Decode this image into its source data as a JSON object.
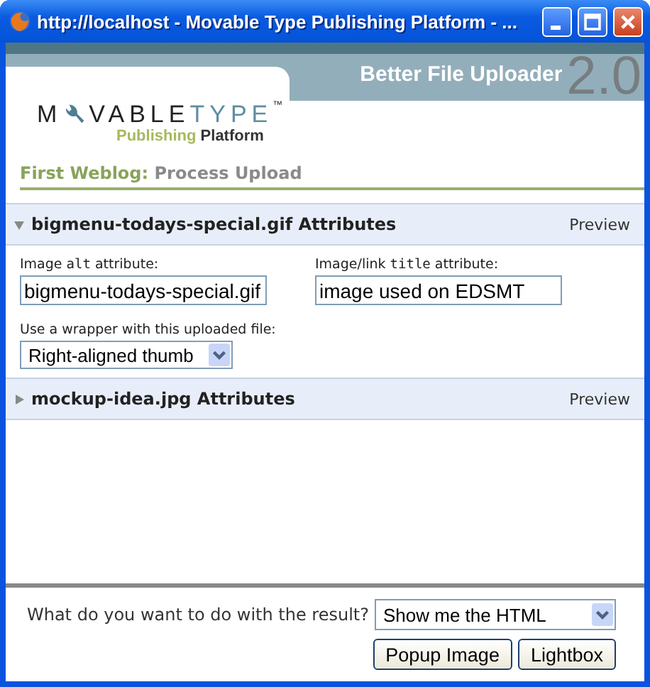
{
  "window": {
    "title": "http://localhost - Movable Type Publishing Platform - ..."
  },
  "logo": {
    "first": "M",
    "rest": "VABLE",
    "accent": "TYPE",
    "mark": "™",
    "tagline_1": "Publishing",
    "tagline_2": "Platform"
  },
  "app_title": "Better File Uploader",
  "version": "2.0",
  "breadcrumb": {
    "blog": "First Weblog:",
    "page": "Process Upload"
  },
  "sections": [
    {
      "title": "bigmenu-todays-special.gif Attributes",
      "preview": "Preview",
      "expanded": true,
      "fields": [
        {
          "label": "Image **alt** attribute:",
          "value": "bigmenu-todays-special.gif"
        },
        {
          "label": "Image/link **title** attribute:",
          "value": "image used on EDSMT"
        }
      ],
      "wrapper": {
        "label": "Use a wrapper with this uploaded file:",
        "value": "Right-aligned thumb"
      }
    },
    {
      "title": "mockup-idea.jpg Attributes",
      "preview": "Preview",
      "expanded": false
    }
  ],
  "footer": {
    "question": "What do you want to do with the result?",
    "choice": "Show me the HTML",
    "buttons": [
      "Popup Image",
      "Lightbox"
    ]
  }
}
